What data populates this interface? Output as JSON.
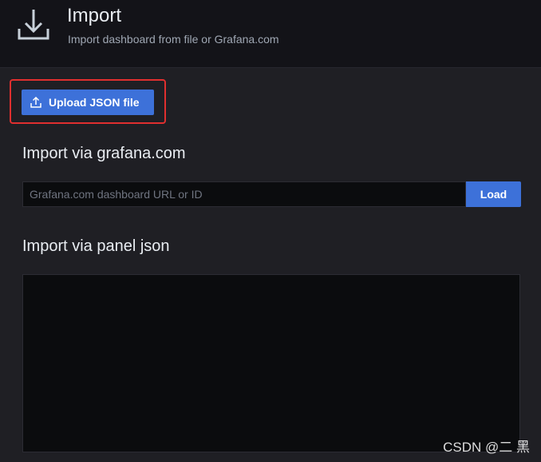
{
  "header": {
    "title": "Import",
    "subtitle": "Import dashboard from file or Grafana.com",
    "icon": "import-download-icon"
  },
  "upload": {
    "label": "Upload JSON file",
    "icon": "upload-icon",
    "highlighted": true,
    "highlight_color": "#e02f2f"
  },
  "grafana_com": {
    "heading": "Import via grafana.com",
    "input_value": "",
    "input_placeholder": "Grafana.com dashboard URL or ID",
    "load_label": "Load"
  },
  "panel_json": {
    "heading": "Import via panel json",
    "value": ""
  },
  "watermark": "CSDN @二 黑",
  "colors": {
    "accent": "#3d71d9",
    "background": "#1f1f24",
    "header_bg": "#131318",
    "input_bg": "#0b0c0e"
  }
}
